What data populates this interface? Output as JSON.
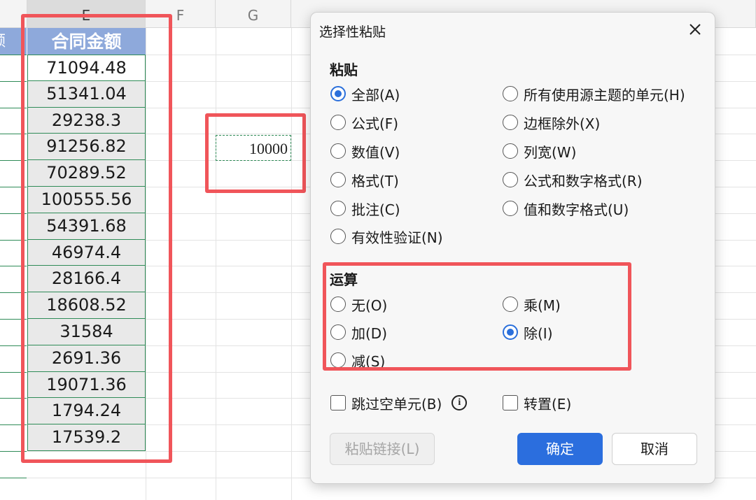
{
  "sheet": {
    "col_e": "E",
    "col_f": "F",
    "col_g": "G",
    "header_partial": "额",
    "header_e": "合同金额",
    "values": [
      "71094.48",
      "51341.04",
      "29238.3",
      "91256.82",
      "70289.52",
      "100555.56",
      "54391.68",
      "46974.4",
      "28166.4",
      "18608.52",
      "31584",
      "2691.36",
      "19071.36",
      "1794.24",
      "17539.2"
    ],
    "g_value": "10000"
  },
  "dialog": {
    "title": "选择性粘贴",
    "paste_section": "粘贴",
    "paste_left": [
      "全部(A)",
      "公式(F)",
      "数值(V)",
      "格式(T)",
      "批注(C)",
      "有效性验证(N)"
    ],
    "paste_right": [
      "所有使用源主题的单元(H)",
      "边框除外(X)",
      "列宽(W)",
      "公式和数字格式(R)",
      "值和数字格式(U)"
    ],
    "paste_selected": "全部(A)",
    "op_section": "运算",
    "op_left": [
      "无(O)",
      "加(D)",
      "减(S)"
    ],
    "op_right": [
      "乘(M)",
      "除(I)"
    ],
    "op_selected": "除(I)",
    "skip_blanks": "跳过空单元(B)",
    "transpose": "转置(E)",
    "paste_link": "粘贴链接(L)",
    "ok": "确定",
    "cancel": "取消"
  },
  "colors": {
    "header_fill": "#8ea9db",
    "highlight_red": "#f0555a",
    "primary_blue": "#2b6ede",
    "cell_border_green": "#2e8b57"
  }
}
